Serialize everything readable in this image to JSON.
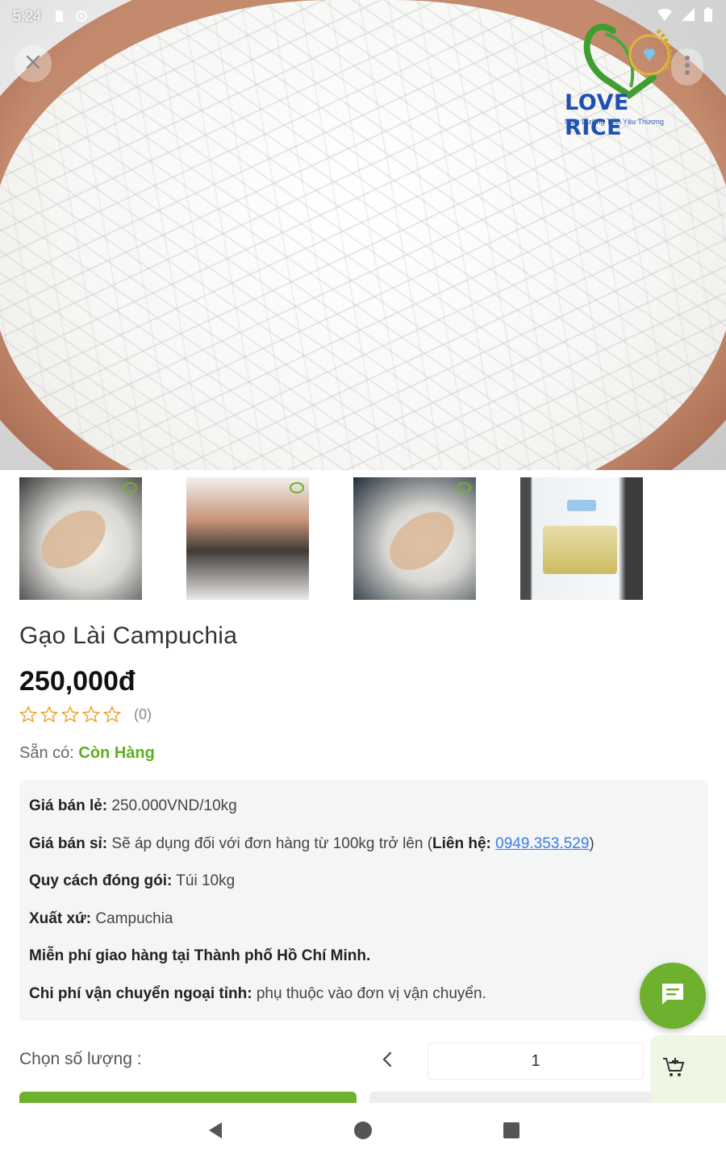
{
  "status_bar": {
    "time": "5:24"
  },
  "brand": {
    "name": "LOVE RICE",
    "tagline": "Nuôi Dưỡng Tình Yêu Thương"
  },
  "product": {
    "title": "Gạo Lài Campuchia",
    "price": "250,000đ",
    "rating": 0,
    "rating_max": 5,
    "rating_count": "(0)",
    "availability_label": "Sẵn có:",
    "availability_value": "Còn Hàng"
  },
  "details": {
    "retail_label": "Giá bán lẻ:",
    "retail_value": "250.000VND/10kg",
    "wholesale_label": "Giá bán sỉ:",
    "wholesale_value": "Sẽ áp dụng đối với đơn hàng từ 100kg trở lên (",
    "contact_label": "Liên hệ:",
    "contact_phone": "0949.353.529",
    "wholesale_close": ")",
    "packing_label": "Quy cách đóng gói:",
    "packing_value": "Túi 10kg",
    "origin_label": "Xuất xứ:",
    "origin_value": "Campuchia",
    "free_shipping": "Miễn phí giao hàng tại Thành phố Hồ Chí Minh.",
    "shipping_label": "Chi phí vận chuyển ngoại tỉnh:",
    "shipping_value": "phụ thuộc vào đơn vị vận chuyển."
  },
  "quantity": {
    "label": "Chọn số lượng :",
    "value": "1"
  },
  "colors": {
    "accent_green": "#6db12f",
    "link_blue": "#3a7ee0",
    "brand_blue": "#1e4fb3"
  },
  "icons": [
    "close-icon",
    "more-vertical-icon",
    "star-outline-icon",
    "chat-icon",
    "chevron-left-icon",
    "add-to-cart-icon",
    "nav-back-icon",
    "nav-home-icon",
    "nav-recents-icon"
  ]
}
